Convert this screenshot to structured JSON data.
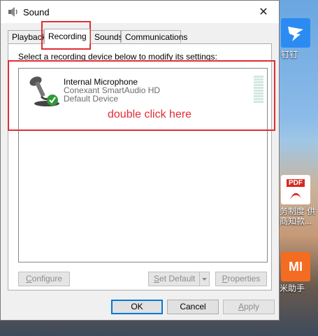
{
  "dialog": {
    "title": "Sound",
    "close_glyph": "✕"
  },
  "tabs": [
    {
      "label": "Playback",
      "active": false
    },
    {
      "label": "Recording",
      "active": true
    },
    {
      "label": "Sounds",
      "active": false
    },
    {
      "label": "Communications",
      "active": false
    }
  ],
  "recording": {
    "instruction": "Select a recording device below to modify its settings:",
    "devices": [
      {
        "name": "Internal Microphone",
        "driver": "Conexant SmartAudio HD",
        "status": "Default Device",
        "icon": "microphone-icon",
        "status_icon": "green-check-icon"
      }
    ]
  },
  "panel_buttons": {
    "configure_u": "C",
    "configure_rest": "onfigure",
    "setdefault_u": "S",
    "setdefault_rest": "et Default",
    "properties_u": "P",
    "properties_rest": "roperties"
  },
  "footer_buttons": {
    "ok": "OK",
    "cancel": "Cancel",
    "apply_u": "A",
    "apply_rest": "pply"
  },
  "annotation": {
    "text": "double click here",
    "color": "#e02d35"
  },
  "desktop": {
    "icons": [
      {
        "label": "钉钉",
        "icon": "dingtalk-icon"
      },
      {
        "label": "PDF",
        "icon": "pdf-icon"
      },
      {
        "label": "务制度 供",
        "icon": ""
      },
      {
        "label": "商知款...",
        "icon": ""
      },
      {
        "label": "MI",
        "icon": "mi-icon"
      },
      {
        "label": "米助手",
        "icon": ""
      }
    ]
  }
}
